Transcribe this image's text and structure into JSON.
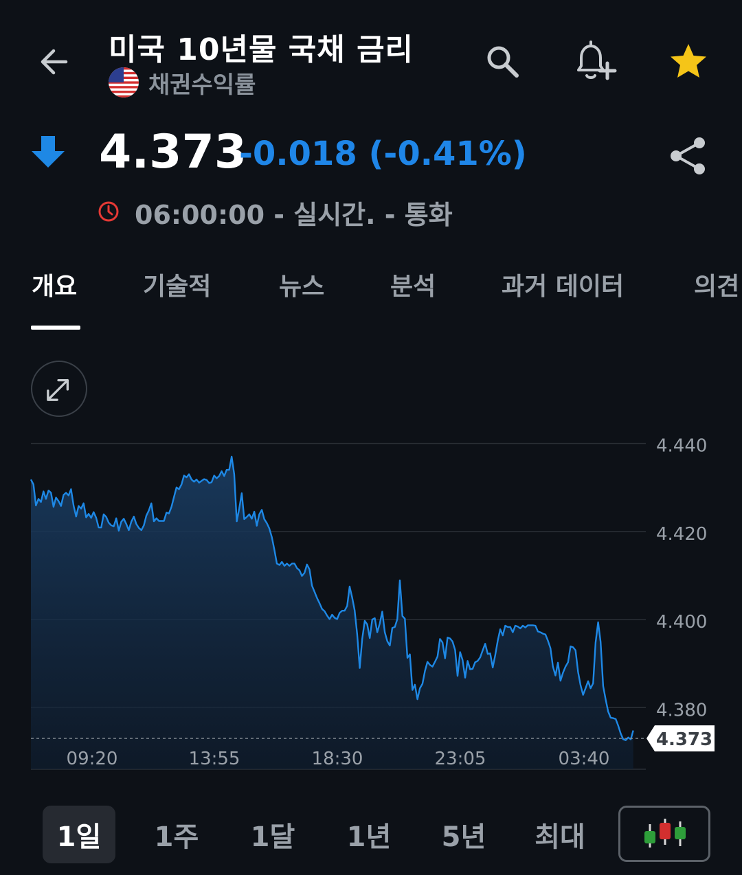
{
  "header": {
    "title": "미국 10년물 국채 금리",
    "subtitle": "채권수익률",
    "icons": [
      "back-arrow-icon",
      "search-icon",
      "add-alert-icon",
      "star-icon"
    ],
    "star_color": "#f5c518"
  },
  "quote": {
    "price": "4.373",
    "change": "-0.018 (-0.41%)",
    "direction": "down",
    "change_color": "#1f86e8",
    "time_status": "06:00:00 - 실시간. - 통화"
  },
  "tabs": [
    {
      "label": "개요",
      "active": true
    },
    {
      "label": "기술적",
      "active": false
    },
    {
      "label": "뉴스",
      "active": false
    },
    {
      "label": "분석",
      "active": false
    },
    {
      "label": "과거 데이터",
      "active": false
    },
    {
      "label": "의견",
      "active": false
    }
  ],
  "ranges": [
    {
      "label": "1일",
      "active": true
    },
    {
      "label": "1주",
      "active": false
    },
    {
      "label": "1달",
      "active": false
    },
    {
      "label": "1년",
      "active": false
    },
    {
      "label": "5년",
      "active": false
    },
    {
      "label": "최대",
      "active": false
    }
  ],
  "chart_data": {
    "type": "area",
    "y_ticks": [
      "4.440",
      "4.420",
      "4.400",
      "4.380"
    ],
    "y_tick_values": [
      4.44,
      4.42,
      4.4,
      4.38
    ],
    "x_ticks": [
      "09:20",
      "13:55",
      "18:30",
      "23:05",
      "03:40"
    ],
    "ylim": [
      4.366,
      4.444
    ],
    "x_range_minutes": [
      0,
      1225
    ],
    "current_label": "4.373",
    "current_value": 4.373,
    "line_color": "#1e88e5",
    "series": [
      {
        "values": [
          [
            0,
            4.4318
          ],
          [
            5,
            4.4307
          ],
          [
            10,
            4.4259
          ],
          [
            15,
            4.4274
          ],
          [
            20,
            4.4267
          ],
          [
            25,
            4.4291
          ],
          [
            30,
            4.4274
          ],
          [
            35,
            4.4293
          ],
          [
            40,
            4.4288
          ],
          [
            45,
            4.4256
          ],
          [
            50,
            4.4277
          ],
          [
            55,
            4.4269
          ],
          [
            60,
            4.4258
          ],
          [
            65,
            4.4283
          ],
          [
            70,
            4.4288
          ],
          [
            75,
            4.4282
          ],
          [
            80,
            4.4296
          ],
          [
            85,
            4.4259
          ],
          [
            90,
            4.4234
          ],
          [
            95,
            4.4258
          ],
          [
            100,
            4.4252
          ],
          [
            105,
            4.4264
          ],
          [
            110,
            4.4232
          ],
          [
            115,
            4.424
          ],
          [
            120,
            4.4231
          ],
          [
            125,
            4.4244
          ],
          [
            130,
            4.4231
          ],
          [
            135,
            4.4209
          ],
          [
            140,
            4.4209
          ],
          [
            145,
            4.4239
          ],
          [
            150,
            4.4233
          ],
          [
            155,
            4.422
          ],
          [
            160,
            4.4214
          ],
          [
            165,
            4.4212
          ],
          [
            170,
            4.423
          ],
          [
            175,
            4.4202
          ],
          [
            180,
            4.4222
          ],
          [
            185,
            4.4229
          ],
          [
            190,
            4.4217
          ],
          [
            195,
            4.4203
          ],
          [
            200,
            4.4222
          ],
          [
            205,
            4.4234
          ],
          [
            210,
            4.4217
          ],
          [
            215,
            4.4208
          ],
          [
            220,
            4.4203
          ],
          [
            225,
            4.4214
          ],
          [
            230,
            4.4236
          ],
          [
            235,
            4.4248
          ],
          [
            240,
            4.4264
          ],
          [
            245,
            4.4223
          ],
          [
            250,
            4.423
          ],
          [
            255,
            4.4224
          ],
          [
            260,
            4.4224
          ],
          [
            265,
            4.4224
          ],
          [
            270,
            4.4243
          ],
          [
            275,
            4.4241
          ],
          [
            280,
            4.4256
          ],
          [
            285,
            4.4278
          ],
          [
            290,
            4.43
          ],
          [
            295,
            4.4296
          ],
          [
            300,
            4.4307
          ],
          [
            305,
            4.4327
          ],
          [
            310,
            4.4323
          ],
          [
            315,
            4.433
          ],
          [
            320,
            4.4318
          ],
          [
            325,
            4.4313
          ],
          [
            330,
            4.4318
          ],
          [
            335,
            4.4311
          ],
          [
            340,
            4.4315
          ],
          [
            345,
            4.4319
          ],
          [
            350,
            4.4317
          ],
          [
            355,
            4.431
          ],
          [
            360,
            4.4312
          ],
          [
            365,
            4.4327
          ],
          [
            370,
            4.4321
          ],
          [
            375,
            4.4326
          ],
          [
            380,
            4.4337
          ],
          [
            385,
            4.4326
          ],
          [
            390,
            4.434
          ],
          [
            395,
            4.434
          ],
          [
            400,
            4.437
          ],
          [
            405,
            4.433
          ],
          [
            410,
            4.4223
          ],
          [
            415,
            4.4252
          ],
          [
            420,
            4.4287
          ],
          [
            425,
            4.4228
          ],
          [
            430,
            4.4233
          ],
          [
            435,
            4.4239
          ],
          [
            440,
            4.4229
          ],
          [
            445,
            4.4245
          ],
          [
            450,
            4.4213
          ],
          [
            455,
            4.4239
          ],
          [
            460,
            4.4249
          ],
          [
            465,
            4.4228
          ],
          [
            470,
            4.4219
          ],
          [
            475,
            4.4207
          ],
          [
            480,
            4.4187
          ],
          [
            485,
            4.4159
          ],
          [
            490,
            4.4127
          ],
          [
            495,
            4.4124
          ],
          [
            500,
            4.4131
          ],
          [
            505,
            4.4122
          ],
          [
            510,
            4.4127
          ],
          [
            515,
            4.4122
          ],
          [
            520,
            4.4127
          ],
          [
            525,
            4.4127
          ],
          [
            530,
            4.4117
          ],
          [
            535,
            4.4112
          ],
          [
            540,
            4.4099
          ],
          [
            545,
            4.4106
          ],
          [
            550,
            4.4125
          ],
          [
            555,
            4.4114
          ],
          [
            560,
            4.4077
          ],
          [
            565,
            4.4063
          ],
          [
            570,
            4.4049
          ],
          [
            575,
            4.4037
          ],
          [
            580,
            4.4024
          ],
          [
            585,
            4.4019
          ],
          [
            590,
            4.4009
          ],
          [
            595,
            4.4001
          ],
          [
            600,
            4.4011
          ],
          [
            605,
            4.4004
          ],
          [
            610,
            4.4001
          ],
          [
            615,
            4.4015
          ],
          [
            620,
            4.402
          ],
          [
            625,
            4.402
          ],
          [
            630,
            4.4031
          ],
          [
            635,
            4.4075
          ],
          [
            640,
            4.405
          ],
          [
            645,
            4.4021
          ],
          [
            650,
            4.3966
          ],
          [
            655,
            4.389
          ],
          [
            660,
            4.3956
          ],
          [
            665,
            4.3997
          ],
          [
            670,
            4.3989
          ],
          [
            675,
            4.3958
          ],
          [
            680,
            4.4
          ],
          [
            685,
            4.4003
          ],
          [
            690,
            4.3971
          ],
          [
            695,
            4.3991
          ],
          [
            700,
            4.4018
          ],
          [
            705,
            4.3971
          ],
          [
            710,
            4.3951
          ],
          [
            715,
            4.3941
          ],
          [
            720,
            4.3981
          ],
          [
            725,
            4.3983
          ],
          [
            730,
            4.4001
          ],
          [
            735,
            4.4089
          ],
          [
            740,
            4.4008
          ],
          [
            745,
            4.4002
          ],
          [
            750,
            4.3913
          ],
          [
            755,
            4.3921
          ],
          [
            760,
            4.384
          ],
          [
            765,
            4.3852
          ],
          [
            770,
            4.3819
          ],
          [
            775,
            4.3844
          ],
          [
            780,
            4.3854
          ],
          [
            785,
            4.3883
          ],
          [
            790,
            4.3904
          ],
          [
            795,
            4.3897
          ],
          [
            800,
            4.3893
          ],
          [
            805,
            4.3904
          ],
          [
            810,
            4.3916
          ],
          [
            815,
            4.3956
          ],
          [
            820,
            4.3948
          ],
          [
            825,
            4.3912
          ],
          [
            830,
            4.3959
          ],
          [
            835,
            4.3957
          ],
          [
            840,
            4.395
          ],
          [
            845,
            4.3931
          ],
          [
            850,
            4.3872
          ],
          [
            855,
            4.3926
          ],
          [
            860,
            4.3908
          ],
          [
            865,
            4.3868
          ],
          [
            870,
            4.3906
          ],
          [
            875,
            4.3887
          ],
          [
            880,
            4.3888
          ],
          [
            885,
            4.3903
          ],
          [
            890,
            4.3906
          ],
          [
            895,
            4.3914
          ],
          [
            900,
            4.393
          ],
          [
            905,
            4.3945
          ],
          [
            910,
            4.3922
          ],
          [
            915,
            4.3923
          ],
          [
            920,
            4.3891
          ],
          [
            925,
            4.3919
          ],
          [
            930,
            4.3952
          ],
          [
            935,
            4.3978
          ],
          [
            940,
            4.3964
          ],
          [
            945,
            4.3986
          ],
          [
            950,
            4.3983
          ],
          [
            955,
            4.3983
          ],
          [
            960,
            4.3971
          ],
          [
            965,
            4.3986
          ],
          [
            970,
            4.3984
          ],
          [
            975,
            4.398
          ],
          [
            980,
            4.3986
          ],
          [
            985,
            4.3982
          ],
          [
            990,
            4.3987
          ],
          [
            995,
            4.3987
          ],
          [
            1000,
            4.3987
          ],
          [
            1005,
            4.3986
          ],
          [
            1010,
            4.3973
          ],
          [
            1015,
            4.3971
          ],
          [
            1020,
            4.3968
          ],
          [
            1025,
            4.3966
          ],
          [
            1030,
            4.3952
          ],
          [
            1035,
            4.3935
          ],
          [
            1040,
            4.3893
          ],
          [
            1045,
            4.3873
          ],
          [
            1050,
            4.3902
          ],
          [
            1055,
            4.3861
          ],
          [
            1060,
            4.3879
          ],
          [
            1065,
            4.3893
          ],
          [
            1070,
            4.3903
          ],
          [
            1075,
            4.3939
          ],
          [
            1080,
            4.3937
          ],
          [
            1085,
            4.393
          ],
          [
            1090,
            4.3881
          ],
          [
            1095,
            4.3851
          ],
          [
            1100,
            4.3829
          ],
          [
            1105,
            4.3844
          ],
          [
            1110,
            4.386
          ],
          [
            1115,
            4.3844
          ],
          [
            1120,
            4.3855
          ],
          [
            1125,
            4.3948
          ],
          [
            1130,
            4.3994
          ],
          [
            1135,
            4.3949
          ],
          [
            1140,
            4.3849
          ],
          [
            1145,
            4.3818
          ],
          [
            1150,
            4.3791
          ],
          [
            1155,
            4.3777
          ],
          [
            1160,
            4.3776
          ],
          [
            1165,
            4.3774
          ],
          [
            1170,
            4.3759
          ],
          [
            1175,
            4.3741
          ],
          [
            1180,
            4.3728
          ],
          [
            1185,
            4.3726
          ],
          [
            1190,
            4.3732
          ],
          [
            1195,
            4.3728
          ],
          [
            1200,
            4.3748
          ]
        ]
      }
    ]
  }
}
